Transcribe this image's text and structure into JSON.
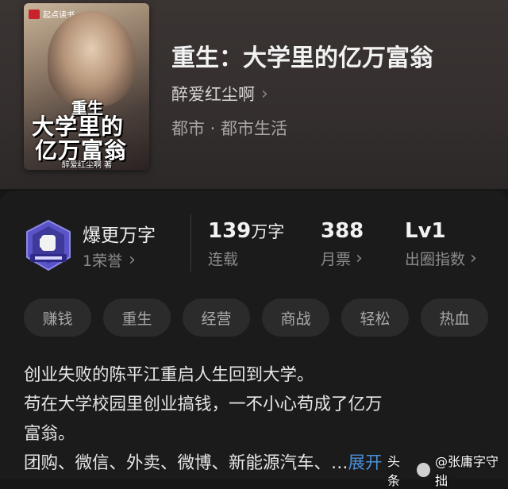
{
  "book": {
    "title": "重生：大学里的亿万富翁",
    "author": "醉爱红尘啊",
    "genre": "都市 · 都市生活"
  },
  "cover": {
    "brand": "起点读书",
    "title_line1": "重生",
    "title_line2": "大学里的",
    "title_line3": "亿万富翁",
    "author_line": "醉爱红尘啊 著"
  },
  "stats": {
    "honor_title": "爆更万字",
    "honor_sub": "1荣誉",
    "words_value": "139",
    "words_unit": "万字",
    "words_label": "连载",
    "tickets_value": "388",
    "tickets_label": "月票",
    "level_value": "Lv1",
    "level_label": "出圈指数"
  },
  "tags": [
    "赚钱",
    "重生",
    "经营",
    "商战",
    "轻松",
    "热血"
  ],
  "description": {
    "line1": "创业失败的陈平江重启人生回到大学。",
    "line2": "苟在大学校园里创业搞钱，一不小心苟成了亿万",
    "line3": "富翁。",
    "line4": "团购、微信、外卖、微博、新能源汽车、…",
    "expand": "展开"
  },
  "watermark": {
    "prefix": "头条",
    "text": "@张庸字守拙"
  },
  "colors": {
    "accent": "#4a90d9",
    "badge": "#5a54c8"
  }
}
